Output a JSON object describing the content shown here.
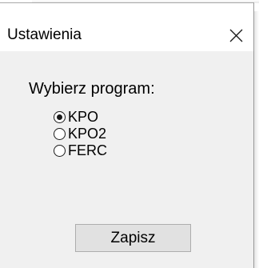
{
  "window": {
    "title": "Ustawienia",
    "close_icon": "close-icon"
  },
  "form": {
    "prompt": "Wybierz program:",
    "options": [
      {
        "label": "KPO",
        "checked": true
      },
      {
        "label": "KPO2",
        "checked": false
      },
      {
        "label": "FERC",
        "checked": false
      }
    ],
    "save_label": "Zapisz"
  }
}
